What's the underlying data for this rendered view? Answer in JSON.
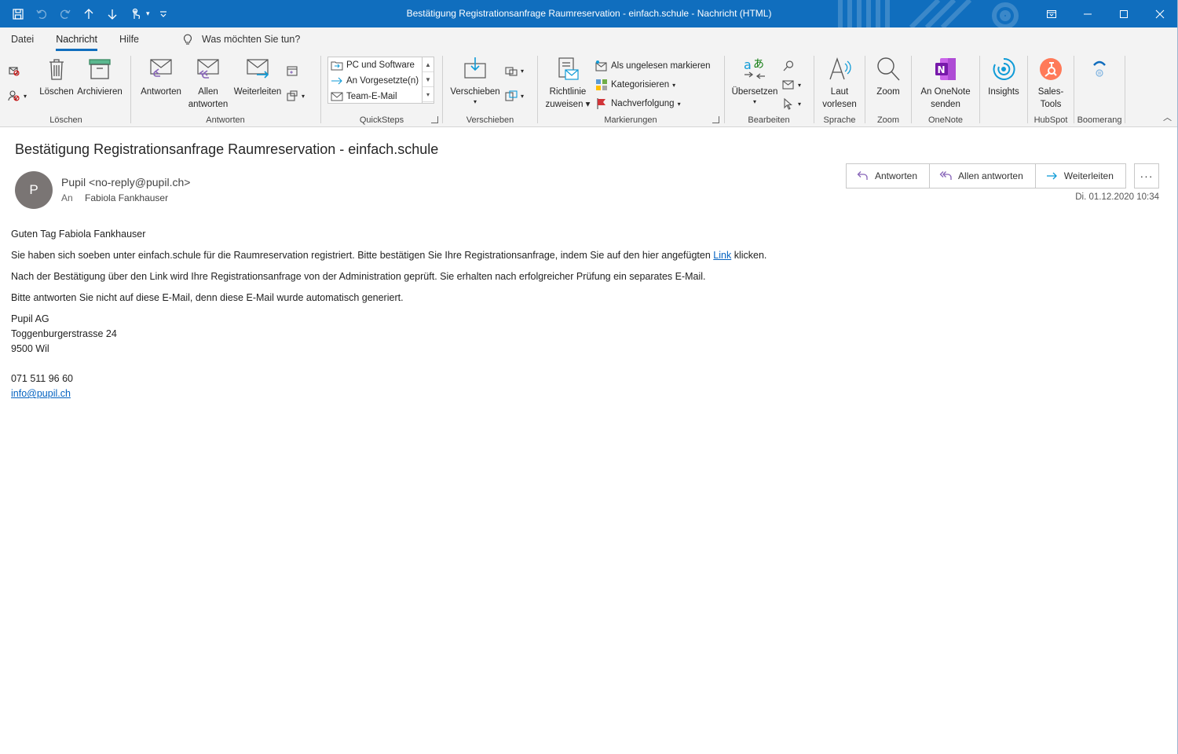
{
  "window": {
    "title": "Bestätigung Registrationsanfrage Raumreservation - einfach.schule  -  Nachricht (HTML)",
    "controls": [
      "ribbon-display-icon",
      "minimize-icon",
      "maximize-icon",
      "close-icon"
    ]
  },
  "menu": {
    "tabs": [
      "Datei",
      "Nachricht",
      "Hilfe"
    ],
    "active": "Nachricht",
    "tell_me": "Was möchten Sie tun?"
  },
  "ribbon": {
    "groups": {
      "loeschen": "Löschen",
      "antworten": "Antworten",
      "quicksteps": "QuickSteps",
      "verschieben": "Verschieben",
      "markierungen": "Markierungen",
      "bearbeiten": "Bearbeiten",
      "sprache": "Sprache",
      "zoom": "Zoom",
      "onenote": "OneNote",
      "hubspot": "HubSpot",
      "boomerang": "Boomerang"
    },
    "buttons": {
      "loeschen": "Löschen",
      "archivieren": "Archivieren",
      "antworten": "Antworten",
      "allen_1": "Allen",
      "allen_2": "antworten",
      "weiterleiten": "Weiterleiten",
      "verschieben": "Verschieben",
      "richtlinie_1": "Richtlinie",
      "richtlinie_2": "zuweisen",
      "ungelesen": "Als ungelesen markieren",
      "kategorisieren": "Kategorisieren",
      "nachverfolgung": "Nachverfolgung",
      "uebersetzen": "Übersetzen",
      "laut_1": "Laut",
      "laut_2": "vorlesen",
      "zoom": "Zoom",
      "onenote_1": "An OneNote",
      "onenote_2": "senden",
      "insights": "Insights",
      "sales_1": "Sales-",
      "sales_2": "Tools"
    },
    "quicksteps": [
      "PC und Software",
      "An Vorgesetzte(n)",
      "Team-E-Mail"
    ]
  },
  "message": {
    "subject": "Bestätigung Registrationsanfrage Raumreservation - einfach.schule",
    "avatar_initial": "P",
    "sender": "Pupil <no-reply@pupil.ch>",
    "to_label": "An",
    "to": "Fabiola Fankhauser",
    "date": "Di. 01.12.2020 10:34",
    "actions": {
      "reply": "Antworten",
      "reply_all": "Allen antworten",
      "forward": "Weiterleiten",
      "more": "···"
    },
    "body": {
      "greeting": "Guten Tag Fabiola Fankhauser",
      "p1_before": "Sie haben sich soeben unter einfach.schule für die Raumreservation registriert. Bitte bestätigen Sie Ihre Registrationsanfrage, indem Sie auf den hier angefügten ",
      "p1_link": "Link",
      "p1_after": " klicken.",
      "p2": "Nach der Bestätigung über den Link wird Ihre Registrationsanfrage von der Administration geprüft. Sie erhalten nach erfolgreicher Prüfung ein separates E-Mail.",
      "p3": "Bitte antworten Sie nicht auf diese E-Mail, denn diese E-Mail wurde automatisch generiert.",
      "company": "Pupil AG",
      "street": "Toggenburgerstrasse 24",
      "city": "9500 Wil",
      "phone": "071 511 96 60",
      "email": "info@pupil.ch"
    }
  },
  "colors": {
    "titlebar": "#106ebe",
    "accent_purple": "#8764b8",
    "onenote": "#7719aa",
    "hubspot": "#ff7a59",
    "insights": "#0f9bd7",
    "link": "#0563c1"
  }
}
